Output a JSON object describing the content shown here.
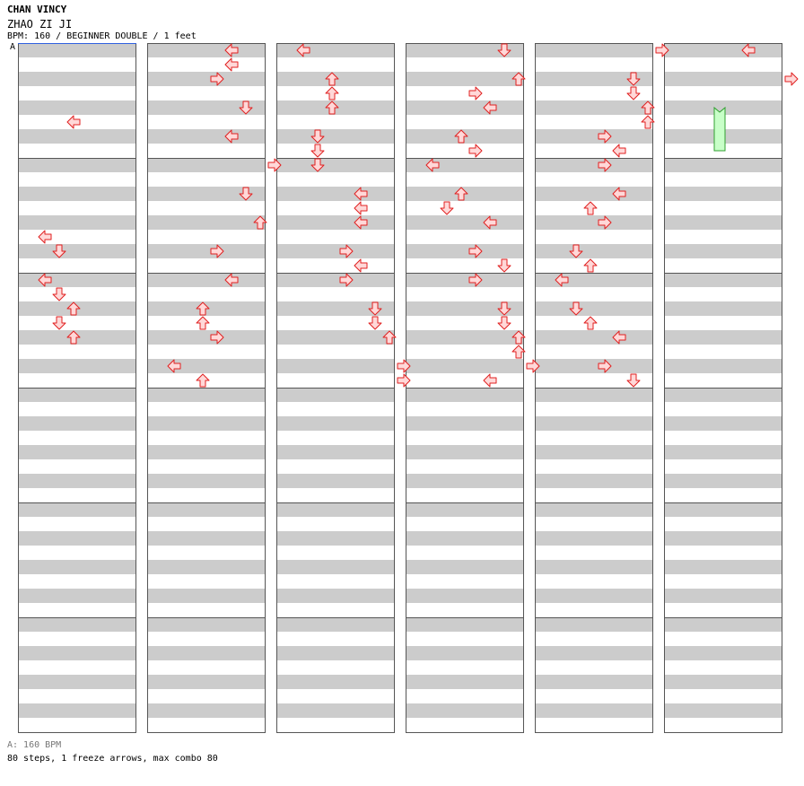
{
  "header": {
    "artist": "CHAN VINCY",
    "song": "ZHAO ZI JI",
    "info": "BPM: 160 / BEGINNER DOUBLE / 1 feet",
    "bpm_marker": "A"
  },
  "footer": {
    "bpm_legend": "A: 160 BPM",
    "stats": "80 steps, 1 freeze arrows, max combo 80"
  },
  "colors": {
    "arrow_fill": "#ffd8d8",
    "arrow_stroke": "#e02020",
    "freeze_fill": "#c8ffc8",
    "freeze_stroke": "#30a030",
    "stripe": "#cccccc",
    "bpm_line": "#3060e0"
  },
  "notes": [
    [
      [
        5,
        2,
        "left"
      ],
      [
        13,
        0,
        "left"
      ],
      [
        14,
        1,
        "down"
      ],
      [
        16,
        0,
        "left"
      ],
      [
        17,
        1,
        "down"
      ],
      [
        18,
        2,
        "up"
      ],
      [
        19,
        1,
        "down"
      ],
      [
        20,
        2,
        "up"
      ]
    ],
    [
      [
        0,
        4,
        "left"
      ],
      [
        1,
        4,
        "left"
      ],
      [
        2,
        3,
        "right"
      ],
      [
        4,
        5,
        "down"
      ],
      [
        6,
        4,
        "left"
      ],
      [
        8,
        7,
        "right"
      ],
      [
        10,
        5,
        "down"
      ],
      [
        12,
        6,
        "up"
      ],
      [
        14,
        3,
        "right"
      ],
      [
        16,
        4,
        "left"
      ],
      [
        18,
        2,
        "up"
      ],
      [
        19,
        2,
        "up"
      ],
      [
        20,
        3,
        "right"
      ],
      [
        22,
        0,
        "left"
      ],
      [
        23,
        2,
        "up"
      ]
    ],
    [
      [
        0,
        0,
        "left"
      ],
      [
        2,
        2,
        "up"
      ],
      [
        3,
        2,
        "up"
      ],
      [
        4,
        2,
        "up"
      ],
      [
        6,
        1,
        "down"
      ],
      [
        7,
        1,
        "down"
      ],
      [
        8,
        1,
        "down"
      ],
      [
        10,
        4,
        "left"
      ],
      [
        11,
        4,
        "left"
      ],
      [
        12,
        4,
        "left"
      ],
      [
        14,
        3,
        "right"
      ],
      [
        15,
        4,
        "left"
      ],
      [
        16,
        3,
        "right"
      ],
      [
        18,
        5,
        "down"
      ],
      [
        19,
        5,
        "down"
      ],
      [
        20,
        6,
        "up"
      ],
      [
        22,
        7,
        "right"
      ],
      [
        23,
        7,
        "right"
      ]
    ],
    [
      [
        0,
        5,
        "down"
      ],
      [
        2,
        6,
        "up"
      ],
      [
        3,
        3,
        "right"
      ],
      [
        4,
        4,
        "left"
      ],
      [
        6,
        2,
        "up"
      ],
      [
        7,
        3,
        "right"
      ],
      [
        8,
        0,
        "left"
      ],
      [
        10,
        2,
        "up"
      ],
      [
        11,
        1,
        "down"
      ],
      [
        12,
        4,
        "left"
      ],
      [
        14,
        3,
        "right"
      ],
      [
        15,
        5,
        "down"
      ],
      [
        16,
        3,
        "right"
      ],
      [
        18,
        5,
        "down"
      ],
      [
        19,
        5,
        "down"
      ],
      [
        20,
        6,
        "up"
      ],
      [
        21,
        6,
        "up"
      ],
      [
        22,
        7,
        "right"
      ],
      [
        23,
        4,
        "left"
      ]
    ],
    [
      [
        0,
        7,
        "right"
      ],
      [
        2,
        5,
        "down"
      ],
      [
        3,
        5,
        "down"
      ],
      [
        4,
        6,
        "up"
      ],
      [
        5,
        6,
        "up"
      ],
      [
        6,
        3,
        "right"
      ],
      [
        7,
        4,
        "left"
      ],
      [
        8,
        3,
        "right"
      ],
      [
        10,
        4,
        "left"
      ],
      [
        11,
        2,
        "up"
      ],
      [
        12,
        3,
        "right"
      ],
      [
        14,
        1,
        "down"
      ],
      [
        15,
        2,
        "up"
      ],
      [
        16,
        0,
        "left"
      ],
      [
        18,
        1,
        "down"
      ],
      [
        19,
        2,
        "up"
      ],
      [
        20,
        4,
        "left"
      ],
      [
        22,
        3,
        "right"
      ],
      [
        23,
        5,
        "down"
      ]
    ],
    [
      [
        0,
        4,
        "left"
      ],
      [
        2,
        7,
        "right"
      ]
    ]
  ],
  "freezes": [
    [
      5,
      2,
      7,
      4
    ]
  ]
}
